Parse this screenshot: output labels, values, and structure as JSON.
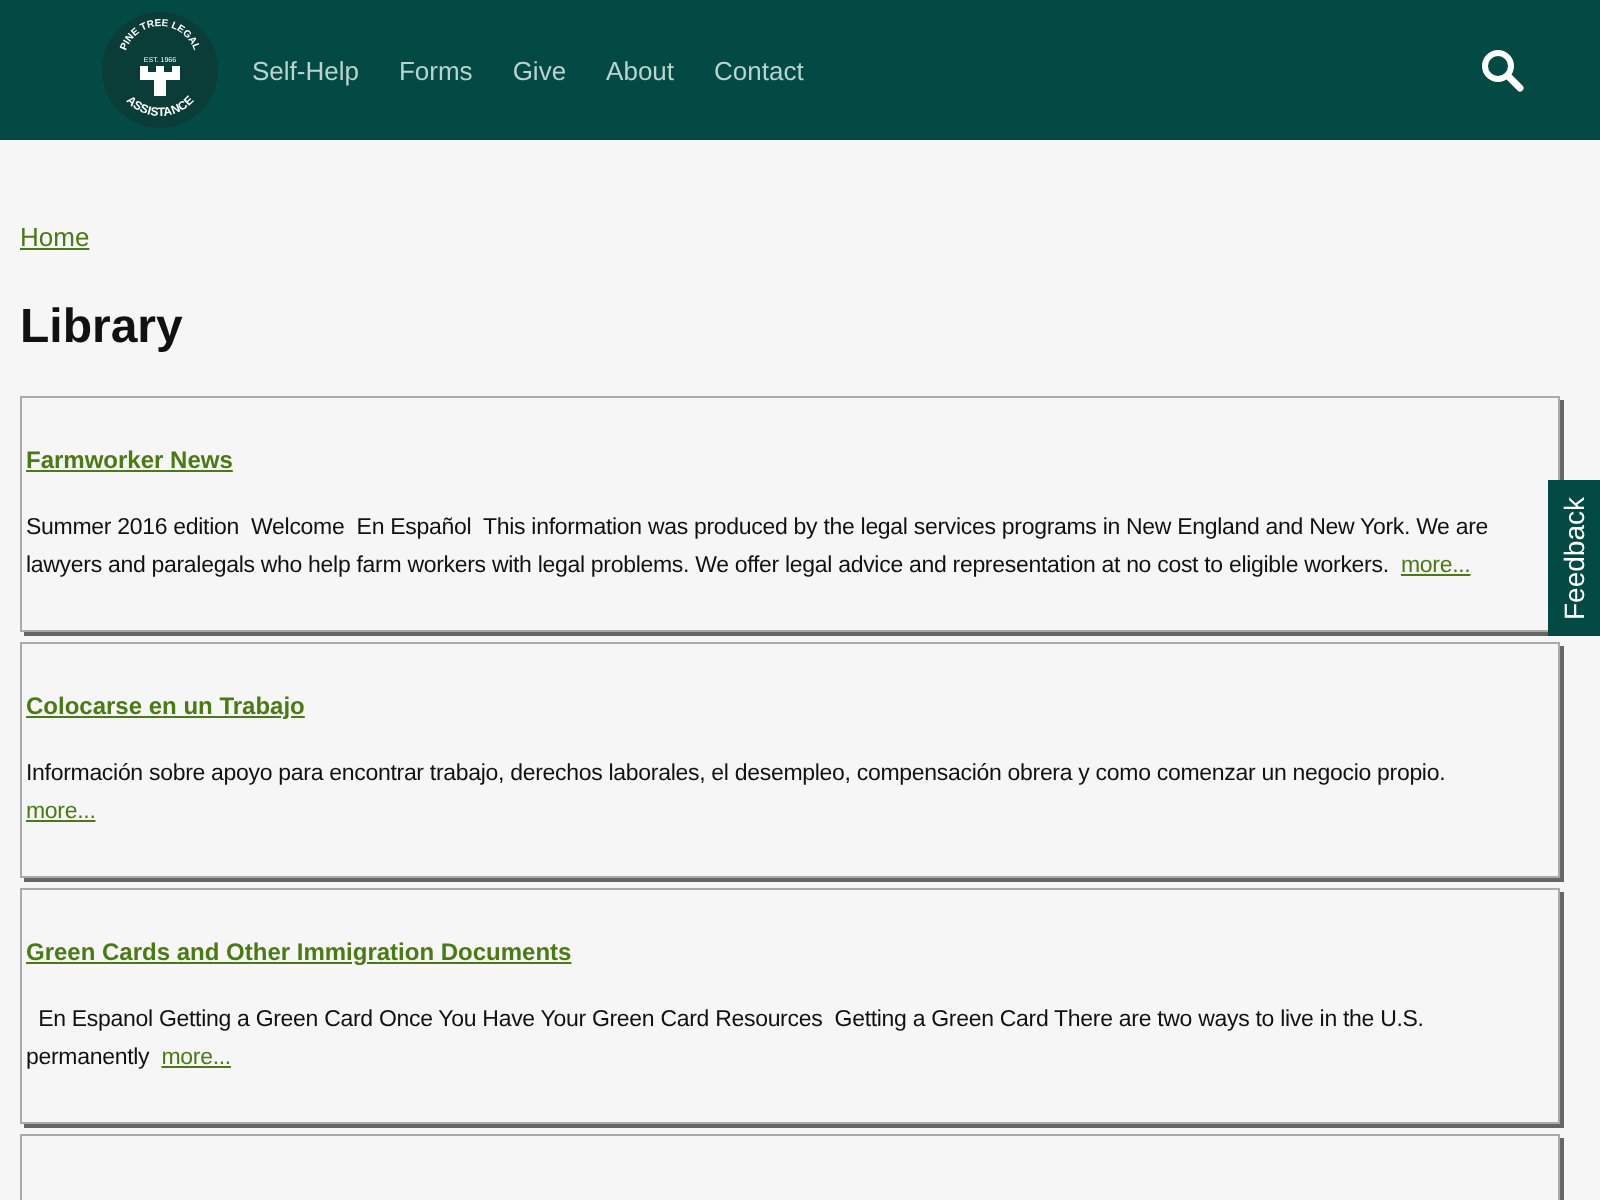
{
  "header": {
    "logo": {
      "top_text": "PINE TREE LEGAL",
      "est": "EST. 1966",
      "bottom_text": "ASSISTANCE"
    },
    "nav": [
      "Self-Help",
      "Forms",
      "Give",
      "About",
      "Contact"
    ]
  },
  "breadcrumb": [
    "Home"
  ],
  "title": "Library",
  "items": [
    {
      "title": "Farmworker News",
      "summary": "Summer 2016 edition  Welcome  En Español  This information was produced by the legal services programs in New England and New York. We are lawyers and paralegals who help farm workers with legal problems. We offer legal advice and representation at no cost to eligible workers.",
      "more": "more..."
    },
    {
      "title": "Colocarse en un Trabajo",
      "summary": "Información sobre apoyo para encontrar trabajo, derechos laborales, el desempleo, compensación obrera y como comenzar un negocio propio.",
      "more": "more..."
    },
    {
      "title": "Green Cards and Other Immigration Documents",
      "summary": "  En Espanol Getting a Green Card Once You Have Your Green Card Resources  Getting a Green Card There are two ways to live in the U.S. permanently",
      "more": "more..."
    }
  ],
  "feedback": "Feedback"
}
